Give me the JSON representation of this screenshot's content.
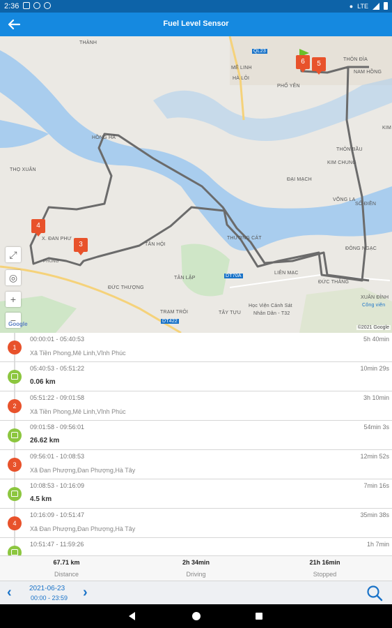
{
  "status_bar": {
    "time": "2:36",
    "network": "LTE",
    "icons": [
      "notification-square-icon",
      "settings-icon",
      "sync-icon",
      "location-icon",
      "signal-icon",
      "battery-icon"
    ]
  },
  "app_bar": {
    "title": "Fuel Level Sensor",
    "back_icon": "arrow-left-icon"
  },
  "map": {
    "labels": [
      "MÊ LINH",
      "HÀ LÔI",
      "PHỐ YÊN",
      "THÔN ĐÌA",
      "NAM HỒNG",
      "KIM",
      "THÔN BẦU",
      "KIM CHUNG",
      "ĐẠI MẠCH",
      "VÕNG LA",
      "SỐ ĐIỀN",
      "ĐÔNG NGẠC",
      "XUÂN ĐỈNH",
      "Công viên",
      "HỒNG HÀ",
      "THỌ XUÂN",
      "X. ĐAN PHƯ",
      "PHUNG",
      "TÂN HỘI",
      "THƯỢNG CÁT",
      "LIÊN MẠC",
      "ĐỨC THẮNG",
      "ĐỨC THƯỢNG",
      "TÂN LẬP",
      "TRẠM TRÔI",
      "TÂY TỰU",
      "Học Viện Cảnh Sát",
      "Nhân Dân - T32",
      "QL23",
      "DT70A",
      "DT422",
      "THÀNH"
    ],
    "markers": [
      "4",
      "3",
      "6",
      "5"
    ],
    "google": "Google",
    "copyright": "©2021 Google",
    "controls": [
      "fullscreen-icon",
      "locate-icon",
      "zoom-in-icon",
      "zoom-out-icon"
    ]
  },
  "trips": [
    {
      "type": "stop",
      "badge": "1",
      "range": "00:00:01 - 05:40:53",
      "duration": "5h 40min",
      "address": "Xã Tiền Phong,Mê Linh,Vĩnh Phúc"
    },
    {
      "type": "move",
      "range": "05:40:53 - 05:51:22",
      "duration": "10min 29s",
      "distance": "0.06 km"
    },
    {
      "type": "stop",
      "badge": "2",
      "range": "05:51:22 - 09:01:58",
      "duration": "3h 10min",
      "address": "Xã Tiền Phong,Mê Linh,Vĩnh Phúc"
    },
    {
      "type": "move",
      "range": "09:01:58 - 09:56:01",
      "duration": "54min 3s",
      "distance": "26.62 km"
    },
    {
      "type": "stop",
      "badge": "3",
      "range": "09:56:01 - 10:08:53",
      "duration": "12min 52s",
      "address": "Xã Đan Phượng,Đan Phượng,Hà Tây"
    },
    {
      "type": "move",
      "range": "10:08:53 - 10:16:09",
      "duration": "7min 16s",
      "distance": "4.5 km"
    },
    {
      "type": "stop",
      "badge": "4",
      "range": "10:16:09 - 10:51:47",
      "duration": "35min 38s",
      "address": "Xã Đan Phượng,Đan Phượng,Hà Tây"
    },
    {
      "type": "move",
      "range": "10:51:47 - 11:59:26",
      "duration": "1h 7min",
      "distance": ""
    }
  ],
  "summary": [
    {
      "value": "67.71 km",
      "label": "Distance"
    },
    {
      "value": "2h 34min",
      "label": "Driving"
    },
    {
      "value": "21h 16min",
      "label": "Stopped"
    }
  ],
  "date_bar": {
    "date": "2021-06-23",
    "hours": "00:00 - 23:59"
  },
  "colors": {
    "primary": "#1589e0",
    "stop": "#e8522b",
    "move": "#8cc63f",
    "route": "#6b6b6b",
    "water": "#a9cdee"
  }
}
